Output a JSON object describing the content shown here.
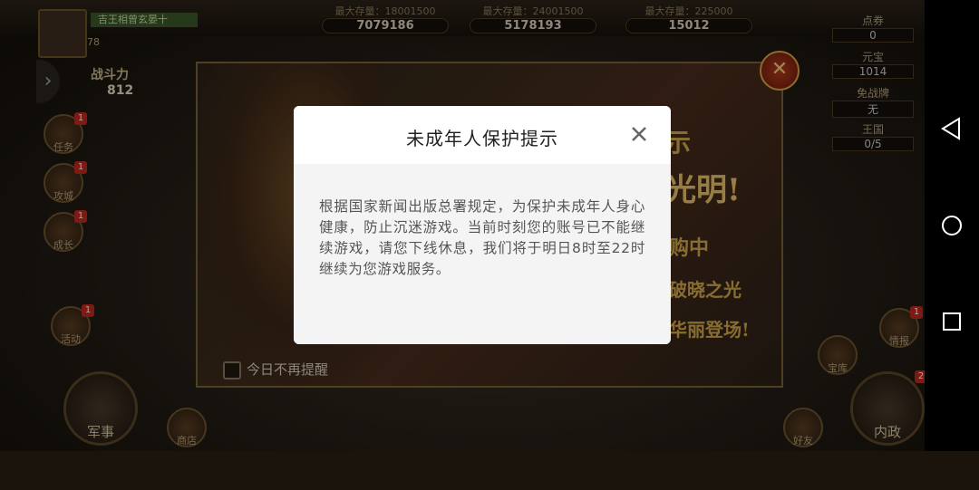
{
  "game": {
    "player_name": "吉王相曾玄晏十",
    "player_level": "78",
    "combat_label": "战斗力",
    "combat_value": "812",
    "resources": [
      {
        "caption": "最大存量：18001500",
        "value": "7079186"
      },
      {
        "caption": "最大存量：24001500",
        "value": "5178193"
      },
      {
        "caption": "最大存量：225000",
        "value": "15012"
      }
    ],
    "side_stats": [
      {
        "label": "点券",
        "value": "0"
      },
      {
        "label": "元宝",
        "value": "1014"
      },
      {
        "label": "免战牌",
        "value": "无"
      },
      {
        "label": "王国",
        "value": "0/5"
      }
    ],
    "left_buttons": [
      "任务",
      "攻城",
      "成长"
    ],
    "left_buttons_extra": "活动",
    "bottom_left_button": "军事",
    "bottom_mid_button": "商店",
    "bottom_right_button": "内政",
    "right_buttons": [
      "情报",
      "宝库",
      "好友"
    ],
    "badge_counts": [
      "1",
      "1",
      "1",
      "1",
      "1",
      "2"
    ]
  },
  "event": {
    "text_line1": "示",
    "text_line2": "光明!",
    "text_line3": "购中",
    "text_line4": "破晓之光",
    "text_line5": "华丽登场!",
    "dont_remind_label": "今日不再提醒"
  },
  "dialog": {
    "title": "未成年人保护提示",
    "body": "根据国家新闻出版总署规定，为保护未成年人身心健康，防止沉迷游戏。当前时刻您的账号已不能继续游戏，请您下线休息，我们将于明日8时至22时继续为您游戏服务。"
  },
  "icons": {
    "dialog_close": "close-icon",
    "event_close": "event-close-icon",
    "nav_back": "back-triangle-icon",
    "nav_home": "home-circle-icon",
    "nav_recent": "recent-square-icon"
  }
}
